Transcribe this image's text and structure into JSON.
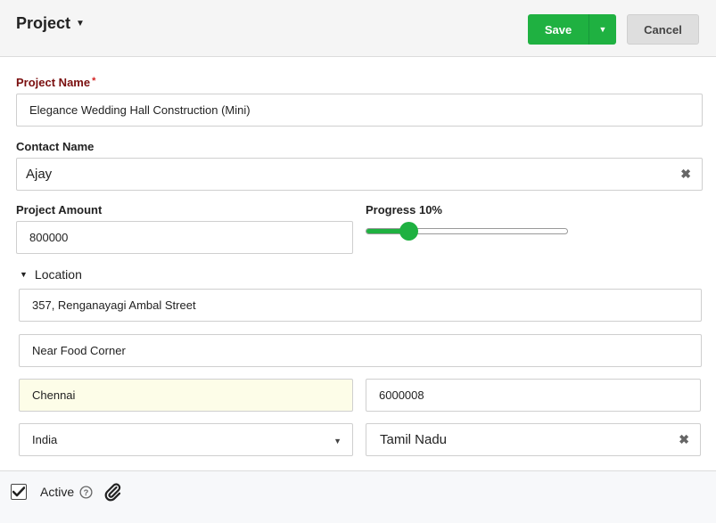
{
  "header": {
    "title": "Project",
    "save_label": "Save",
    "cancel_label": "Cancel"
  },
  "form": {
    "project_name": {
      "label": "Project Name",
      "required_mark": "*",
      "value": "Elegance Wedding Hall Construction (Mini)"
    },
    "contact_name": {
      "label": "Contact Name",
      "value": "Ajay"
    },
    "project_amount": {
      "label": "Project Amount",
      "value": "800000"
    },
    "progress": {
      "label": "Progress 10%",
      "value_percent": 10
    }
  },
  "location": {
    "label": "Location",
    "street1": "357, Renganayagi Ambal Street",
    "street2": "Near Food Corner",
    "city": "Chennai",
    "postal_code": "6000008",
    "country": "India",
    "state": "Tamil Nadu"
  },
  "footer": {
    "active_label": "Active"
  },
  "colors": {
    "accent": "#1fb141",
    "required_label": "#7a0f0f",
    "required_star": "#d21f1f",
    "highlight_field": "#fdfde8"
  },
  "icons": {
    "title_dropdown": "caret-down-icon",
    "save_dropdown": "caret-down-icon",
    "clear": "close-icon",
    "section_toggle": "triangle-down-icon",
    "check": "checkmark-icon",
    "help": "question-circle-icon",
    "attachment": "paperclip-icon"
  }
}
